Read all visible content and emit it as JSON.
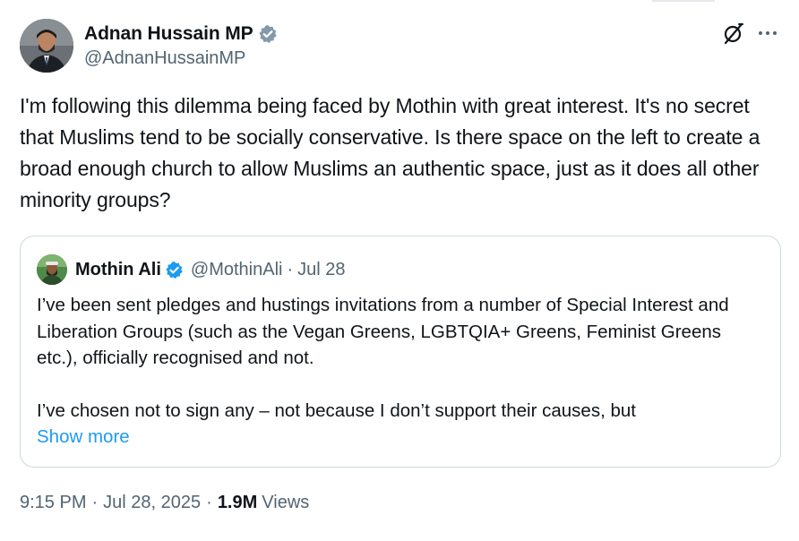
{
  "author": {
    "display_name": "Adnan Hussain MP",
    "handle": "@AdnanHussainMP",
    "verified_icon": "verified-badge-icon"
  },
  "tweet": {
    "text": "I'm following this dilemma being faced by Mothin with great interest. It's no secret that Muslims tend to be socially conservative. Is there space on the left to create a broad enough church to allow Muslims an authentic space, just as it does all other minority groups?"
  },
  "quoted": {
    "display_name": "Mothin Ali",
    "handle": "@MothinAli",
    "separator": "·",
    "date": "Jul 28",
    "para1": "I’ve been sent pledges and hustings invitations from a number of Special Interest and Liberation Groups (such as the Vegan Greens, LGBTQIA+ Greens, Feminist Greens etc.), officially recognised and not.",
    "para2": "I’ve chosen not to sign any – not because I don’t support their causes, but",
    "show_more": "Show more"
  },
  "meta": {
    "time": "9:15 PM",
    "separator": "·",
    "date": "Jul 28, 2025",
    "views_count": "1.9M",
    "views_label": "Views"
  },
  "colors": {
    "accent": "#1d9bf0",
    "secondary_text": "#536471",
    "primary_text": "#0f1419",
    "border": "#cfd9de"
  }
}
